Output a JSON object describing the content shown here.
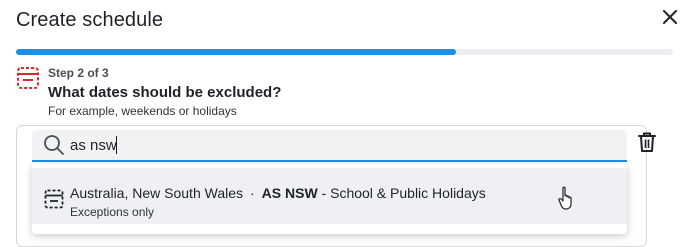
{
  "dialog": {
    "title": "Create schedule",
    "close_icon": "close-icon"
  },
  "progress": {
    "fraction": 0.67,
    "color": "#1e8fe6"
  },
  "step": {
    "label": "Step 2 of 3",
    "question": "What dates should be excluded?",
    "hint": "For example, weekends or holidays",
    "icon": "calendar-dashed-icon",
    "accent": "#e0262f"
  },
  "search": {
    "value": "as nsw",
    "icon": "search-icon"
  },
  "actions": {
    "delete_icon": "trash-icon"
  },
  "results": [
    {
      "region": "Australia, New South Wales",
      "separator": "·",
      "code": "AS NSW",
      "description": " - School & Public Holidays",
      "note": "Exceptions only",
      "icon": "calendar-dashed-icon"
    }
  ]
}
